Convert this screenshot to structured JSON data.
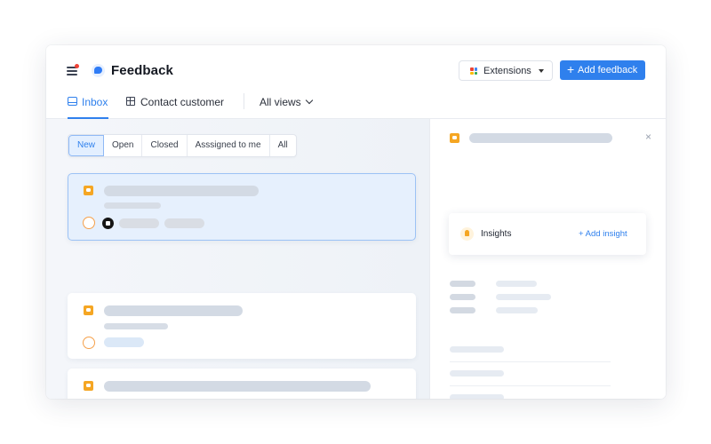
{
  "app": {
    "title": "Feedback"
  },
  "toolbar": {
    "extensions_label": "Extensions",
    "add_feedback_label": "Add feedback",
    "add_feedback_icon": "plus-icon",
    "accent_color": "#2f80ed"
  },
  "tabs": [
    {
      "label": "Inbox",
      "icon": "inbox-icon",
      "active": true
    },
    {
      "label": "Contact customer",
      "icon": "table-icon",
      "active": false
    }
  ],
  "views": {
    "label": "All views"
  },
  "filters": [
    {
      "label": "New",
      "active": true
    },
    {
      "label": "Open",
      "active": false
    },
    {
      "label": "Closed",
      "active": false
    },
    {
      "label": "Asssigned to me",
      "active": false
    },
    {
      "label": "All",
      "active": false
    }
  ],
  "detail": {
    "close_glyph": "×",
    "insights_label": "Insights",
    "add_insight_label": "+ Add insight"
  },
  "colors": {
    "status_orange": "#f5a623",
    "notification_red": "#f04438"
  }
}
